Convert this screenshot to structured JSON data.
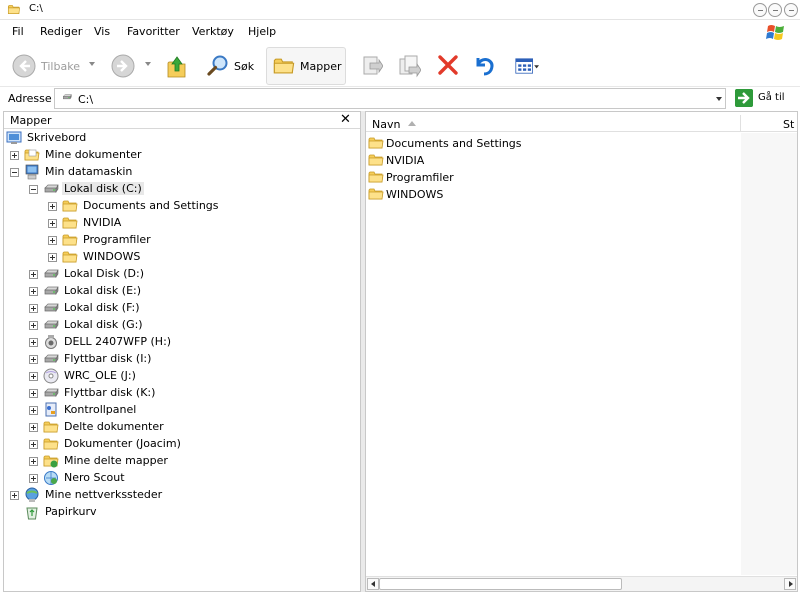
{
  "window": {
    "title": "C:\\"
  },
  "menu": [
    "Fil",
    "Rediger",
    "Vis",
    "Favoritter",
    "Verktøy",
    "Hjelp"
  ],
  "toolbar": {
    "back_label": "Tilbake",
    "search_label": "Søk",
    "folders_label": "Mapper"
  },
  "address": {
    "label": "Adresse",
    "value": "C:\\",
    "go_label": "Gå til"
  },
  "folders_pane": {
    "title": "Mapper",
    "tree": [
      {
        "label": "Skrivebord",
        "icon": "desktop-icon"
      },
      {
        "label": "Mine dokumenter",
        "icon": "my-documents-icon"
      },
      {
        "label": "Min datamaskin",
        "icon": "my-computer-icon"
      },
      {
        "label": "Lokal disk (C:)",
        "icon": "hard-drive-icon"
      },
      {
        "label": "Documents and Settings",
        "icon": "folder-icon"
      },
      {
        "label": "NVIDIA",
        "icon": "folder-icon"
      },
      {
        "label": "Programfiler",
        "icon": "folder-icon"
      },
      {
        "label": "WINDOWS",
        "icon": "folder-icon"
      },
      {
        "label": "Lokal Disk (D:)",
        "icon": "hard-drive-icon"
      },
      {
        "label": "Lokal disk (E:)",
        "icon": "hard-drive-icon"
      },
      {
        "label": "Lokal disk (F:)",
        "icon": "hard-drive-icon"
      },
      {
        "label": "Lokal disk (G:)",
        "icon": "hard-drive-icon"
      },
      {
        "label": "DELL 2407WFP (H:)",
        "icon": "camera-drive-icon"
      },
      {
        "label": "Flyttbar disk (I:)",
        "icon": "removable-drive-icon"
      },
      {
        "label": "WRC_OLE (J:)",
        "icon": "cd-drive-icon"
      },
      {
        "label": "Flyttbar disk (K:)",
        "icon": "removable-drive-icon"
      },
      {
        "label": "Kontrollpanel",
        "icon": "control-panel-icon"
      },
      {
        "label": "Delte dokumenter",
        "icon": "folder-icon"
      },
      {
        "label": "Dokumenter (Joacim)",
        "icon": "folder-icon"
      },
      {
        "label": "Mine delte mapper",
        "icon": "shared-folders-icon"
      },
      {
        "label": "Nero Scout",
        "icon": "nero-scout-icon"
      },
      {
        "label": "Mine nettverkssteder",
        "icon": "network-places-icon"
      },
      {
        "label": "Papirkurv",
        "icon": "recycle-bin-icon"
      }
    ]
  },
  "files_pane": {
    "columns": {
      "name": "Navn",
      "size": "St"
    },
    "items": [
      "Documents and Settings",
      "NVIDIA",
      "Programfiler",
      "WINDOWS"
    ]
  }
}
